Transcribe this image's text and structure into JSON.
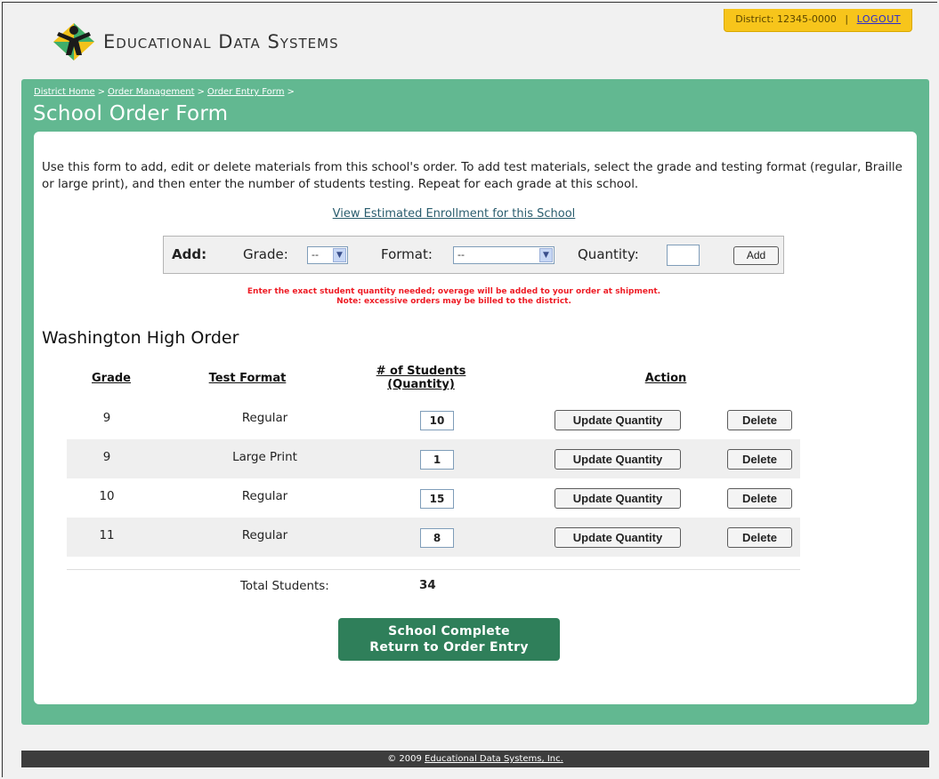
{
  "district_tab": {
    "district_text": "District: 12345-0000",
    "separator": "|",
    "logout_label": "LOGOUT"
  },
  "header": {
    "logo_text": "Educational Data Systems"
  },
  "breadcrumb": {
    "items": [
      "District Home",
      "Order Management",
      "Order Entry Form"
    ],
    "separator": ">"
  },
  "page": {
    "title": "School Order Form"
  },
  "intro": {
    "text": "Use this form to add, edit or delete materials from this school's order. To add test materials, select the grade and testing format (regular, Braille or large print), and then enter the number of students testing. Repeat for each grade at this school."
  },
  "enrollment_link": "View Estimated Enrollment for this School",
  "add_bar": {
    "add_label": "Add:",
    "grade_label": "Grade:",
    "grade_value": "--",
    "format_label": "Format:",
    "format_value": "--",
    "quantity_label": "Quantity:",
    "quantity_value": "",
    "add_button": "Add"
  },
  "warning": {
    "line1": "Enter the exact student quantity needed; overage will be added to your order at shipment.",
    "line2": "Note: excessive orders may be billed to the district."
  },
  "order": {
    "title": "Washington High Order",
    "headers": {
      "grade": "Grade",
      "format": "Test Format",
      "students_line1": "# of Students",
      "students_line2": "(Quantity)",
      "action": "Action"
    },
    "rows": [
      {
        "grade": "9",
        "format": "Regular",
        "quantity": "10"
      },
      {
        "grade": "9",
        "format": "Large Print",
        "quantity": "1"
      },
      {
        "grade": "10",
        "format": "Regular",
        "quantity": "15"
      },
      {
        "grade": "11",
        "format": "Regular",
        "quantity": "8"
      }
    ],
    "update_label": "Update Quantity",
    "delete_label": "Delete",
    "total_label": "Total Students:",
    "total_value": "34"
  },
  "complete_button": {
    "line1": "School Complete",
    "line2": "Return to Order Entry"
  },
  "footer": {
    "copyright": "© 2009",
    "company": "Educational Data Systems, Inc."
  },
  "colors": {
    "panel_green": "#62b891",
    "button_green": "#2f7f5a",
    "district_tab": "#f7c51b",
    "warning_red": "#ee1b24",
    "footer": "#3d3d3d"
  }
}
